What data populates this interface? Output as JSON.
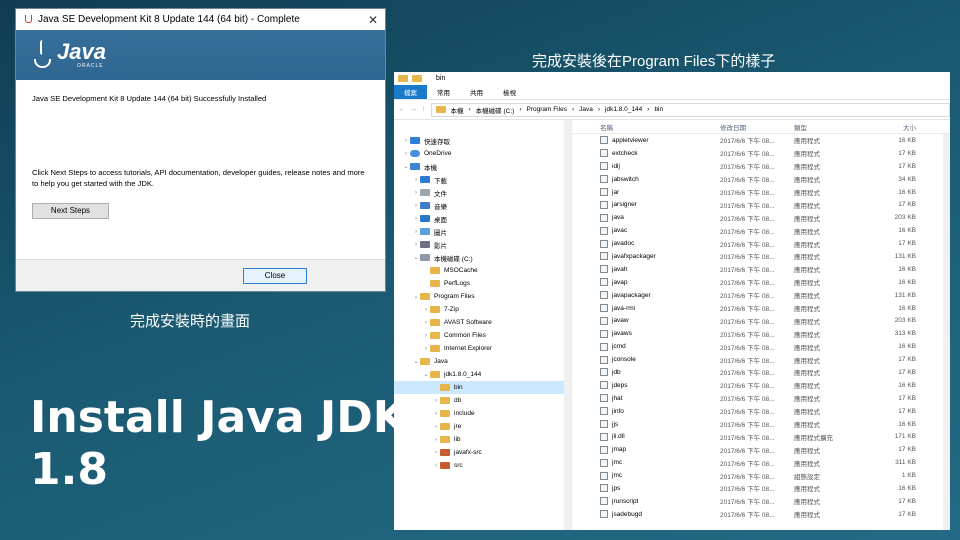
{
  "installer": {
    "title": "Java SE Development Kit 8 Update 144 (64 bit) - Complete",
    "close_glyph": "✕",
    "logo_word": "Java",
    "logo_sub": "ORACLE",
    "line1": "Java SE Development Kit 8 Update 144 (64 bit) Successfully Installed",
    "line2": "Click Next Steps to access tutorials, API documentation, developer guides, release notes and more to help you get started with the JDK.",
    "next_label": "Next Steps",
    "close_label": "Close"
  },
  "captions": {
    "left": "完成安裝時的畫面",
    "right": "完成安裝後在Program Files下的樣子",
    "title_line1": "Install Java JDK",
    "title_line2": "1.8"
  },
  "explorer": {
    "title": "bin",
    "tabs": [
      "檔案",
      "常用",
      "共用",
      "檢視"
    ],
    "breadcrumb": [
      "本機",
      "本機磁碟 (C:)",
      "Program Files",
      "Java",
      "jdk1.8.0_144",
      "bin"
    ],
    "columns": {
      "name": "名稱",
      "date": "修改日期",
      "type": "類型",
      "size": "大小"
    },
    "nav": [
      {
        "label": "快速存取",
        "icon": "star",
        "chev": ">"
      },
      {
        "label": "OneDrive",
        "icon": "cloud",
        "chev": ">"
      },
      {
        "label": "本機",
        "icon": "pc",
        "chev": "v"
      },
      {
        "label": "下載",
        "icon": "dl",
        "chev": ">"
      },
      {
        "label": "文件",
        "icon": "doc",
        "chev": ">"
      },
      {
        "label": "音樂",
        "icon": "music",
        "chev": ">"
      },
      {
        "label": "桌面",
        "icon": "desk",
        "chev": ">"
      },
      {
        "label": "圖片",
        "icon": "pic",
        "chev": ">"
      },
      {
        "label": "影片",
        "icon": "vid",
        "chev": ">"
      },
      {
        "label": "本機磁碟 (C:)",
        "icon": "drive",
        "chev": "v"
      },
      {
        "label": "MSOCache",
        "icon": "folder",
        "chev": ""
      },
      {
        "label": "PerfLogs",
        "icon": "folder",
        "chev": ""
      },
      {
        "label": "Program Files",
        "icon": "folder",
        "chev": "v"
      },
      {
        "label": "7-Zip",
        "icon": "folder",
        "chev": ">"
      },
      {
        "label": "AVAST Software",
        "icon": "folder",
        "chev": ">"
      },
      {
        "label": "Common Files",
        "icon": "folder",
        "chev": ">"
      },
      {
        "label": "Internet Explorer",
        "icon": "folder",
        "chev": ">"
      },
      {
        "label": "Java",
        "icon": "folder",
        "chev": "v"
      },
      {
        "label": "jdk1.8.0_144",
        "icon": "folder",
        "chev": "v"
      },
      {
        "label": "bin",
        "icon": "folder",
        "chev": "",
        "selected": true
      },
      {
        "label": "db",
        "icon": "folder",
        "chev": ">"
      },
      {
        "label": "include",
        "icon": "folder",
        "chev": ">"
      },
      {
        "label": "jre",
        "icon": "folder",
        "chev": ">"
      },
      {
        "label": "lib",
        "icon": "folder",
        "chev": ">"
      },
      {
        "label": "javafx-src",
        "icon": "jar",
        "chev": ">"
      },
      {
        "label": "src",
        "icon": "jar",
        "chev": ">"
      }
    ],
    "files": [
      {
        "name": "appletviewer",
        "date": "2017/6/6 下午 08...",
        "type": "應用程式",
        "size": "16 KB"
      },
      {
        "name": "extcheck",
        "date": "2017/6/6 下午 08...",
        "type": "應用程式",
        "size": "17 KB"
      },
      {
        "name": "idlj",
        "date": "2017/6/6 下午 08...",
        "type": "應用程式",
        "size": "17 KB"
      },
      {
        "name": "jabswitch",
        "date": "2017/6/6 下午 08...",
        "type": "應用程式",
        "size": "34 KB"
      },
      {
        "name": "jar",
        "date": "2017/6/6 下午 08...",
        "type": "應用程式",
        "size": "16 KB"
      },
      {
        "name": "jarsigner",
        "date": "2017/6/6 下午 08...",
        "type": "應用程式",
        "size": "17 KB"
      },
      {
        "name": "java",
        "date": "2017/6/6 下午 08...",
        "type": "應用程式",
        "size": "203 KB"
      },
      {
        "name": "javac",
        "date": "2017/6/6 下午 08...",
        "type": "應用程式",
        "size": "16 KB"
      },
      {
        "name": "javadoc",
        "date": "2017/6/6 下午 08...",
        "type": "應用程式",
        "size": "17 KB"
      },
      {
        "name": "javafxpackager",
        "date": "2017/6/6 下午 08...",
        "type": "應用程式",
        "size": "131 KB"
      },
      {
        "name": "javah",
        "date": "2017/6/6 下午 08...",
        "type": "應用程式",
        "size": "16 KB"
      },
      {
        "name": "javap",
        "date": "2017/6/6 下午 08...",
        "type": "應用程式",
        "size": "16 KB"
      },
      {
        "name": "javapackager",
        "date": "2017/6/6 下午 08...",
        "type": "應用程式",
        "size": "131 KB"
      },
      {
        "name": "java-rmi",
        "date": "2017/6/6 下午 08...",
        "type": "應用程式",
        "size": "16 KB"
      },
      {
        "name": "javaw",
        "date": "2017/6/6 下午 08...",
        "type": "應用程式",
        "size": "203 KB"
      },
      {
        "name": "javaws",
        "date": "2017/6/6 下午 08...",
        "type": "應用程式",
        "size": "313 KB"
      },
      {
        "name": "jcmd",
        "date": "2017/6/6 下午 08...",
        "type": "應用程式",
        "size": "16 KB"
      },
      {
        "name": "jconsole",
        "date": "2017/6/6 下午 08...",
        "type": "應用程式",
        "size": "17 KB"
      },
      {
        "name": "jdb",
        "date": "2017/6/6 下午 08...",
        "type": "應用程式",
        "size": "17 KB"
      },
      {
        "name": "jdeps",
        "date": "2017/6/6 下午 08...",
        "type": "應用程式",
        "size": "16 KB"
      },
      {
        "name": "jhat",
        "date": "2017/6/6 下午 08...",
        "type": "應用程式",
        "size": "17 KB"
      },
      {
        "name": "jinfo",
        "date": "2017/6/6 下午 08...",
        "type": "應用程式",
        "size": "17 KB"
      },
      {
        "name": "jjs",
        "date": "2017/6/6 下午 08...",
        "type": "應用程式",
        "size": "16 KB"
      },
      {
        "name": "jli.dll",
        "date": "2017/6/6 下午 08...",
        "type": "應用程式擴充",
        "size": "171 KB"
      },
      {
        "name": "jmap",
        "date": "2017/6/6 下午 08...",
        "type": "應用程式",
        "size": "17 KB"
      },
      {
        "name": "jmc",
        "date": "2017/6/6 下午 08...",
        "type": "應用程式",
        "size": "311 KB"
      },
      {
        "name": "jmc",
        "date": "2017/6/6 下午 08...",
        "type": "組態設定",
        "size": "1 KB"
      },
      {
        "name": "jps",
        "date": "2017/6/6 下午 08...",
        "type": "應用程式",
        "size": "16 KB"
      },
      {
        "name": "jrunscript",
        "date": "2017/6/6 下午 08...",
        "type": "應用程式",
        "size": "17 KB"
      },
      {
        "name": "jsadebugd",
        "date": "2017/6/6 下午 08...",
        "type": "應用程式",
        "size": "17 KB"
      }
    ]
  }
}
